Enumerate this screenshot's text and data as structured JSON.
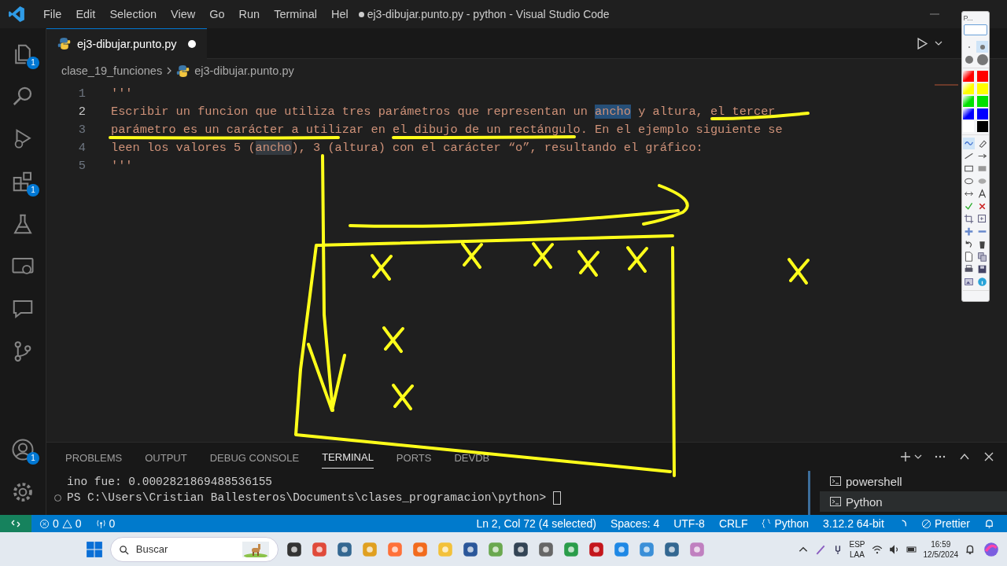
{
  "menu": [
    "File",
    "Edit",
    "Selection",
    "View",
    "Go",
    "Run",
    "Terminal",
    "Hel"
  ],
  "window": {
    "title": "ej3-dibujar.punto.py - python - Visual Studio Code",
    "modified": true
  },
  "activity_bar": {
    "badges": {
      "explorer": "1",
      "extensions": "1",
      "accounts": "1"
    }
  },
  "tab": {
    "label": "ej3-dibujar.punto.py",
    "modified": true
  },
  "breadcrumbs": [
    "clase_19_funciones",
    "ej3-dibujar.punto.py"
  ],
  "code_lines": [
    {
      "number": "1",
      "current": false,
      "parts": [
        {
          "text": "'''",
          "kind": "plain"
        }
      ]
    },
    {
      "number": "2",
      "current": true,
      "parts": [
        {
          "text": "Escribir un funcion que utiliza tres parámetros que representan un ",
          "kind": "plain"
        },
        {
          "text": "ancho",
          "kind": "selection"
        },
        {
          "text": " y altura, el tercer",
          "kind": "plain"
        }
      ]
    },
    {
      "number": "3",
      "current": false,
      "parts": [
        {
          "text": "parámetro es un carácter a utilizar en el dibujo de un rectángulo. En el ejemplo siguiente se",
          "kind": "plain"
        }
      ]
    },
    {
      "number": "4",
      "current": false,
      "parts": [
        {
          "text": "leen los valores 5 (",
          "kind": "plain"
        },
        {
          "text": "ancho",
          "kind": "occurrence"
        },
        {
          "text": "), 3 (altura) con el carácter “o”, resultando el gráfico:",
          "kind": "plain"
        }
      ]
    },
    {
      "number": "5",
      "current": false,
      "parts": [
        {
          "text": "'''",
          "kind": "plain"
        }
      ]
    }
  ],
  "panel_tabs": [
    {
      "label": "PROBLEMS",
      "selected": false
    },
    {
      "label": "OUTPUT",
      "selected": false
    },
    {
      "label": "DEBUG CONSOLE",
      "selected": false
    },
    {
      "label": "TERMINAL",
      "selected": true
    },
    {
      "label": "PORTS",
      "selected": false
    },
    {
      "label": "DEVDB",
      "selected": false
    }
  ],
  "terminal_lines": [
    "ino fue: 0.0002821869488536155",
    "PS C:\\Users\\Cristian Ballesteros\\Documents\\clases_programacion\\python> "
  ],
  "terminals": [
    {
      "label": "powershell",
      "selected": false
    },
    {
      "label": "Python",
      "selected": true
    }
  ],
  "status_bar": {
    "errors": "0",
    "warnings": "0",
    "ports": "0",
    "items": [
      "Ln 2, Col 72 (4 selected)",
      "Spaces: 4",
      "UTF-8",
      "CRLF"
    ],
    "language": "Python",
    "interpreter": "3.12.2 64-bit",
    "formatter": "Prettier"
  },
  "pen_palette": {
    "title": "P...",
    "sizes": [
      {
        "selected": false
      },
      {
        "selected": true
      },
      {
        "selected": false
      },
      {
        "selected": false
      }
    ],
    "swatches": [
      {
        "kind": "gradient",
        "color": "#ff0000"
      },
      {
        "kind": "solid",
        "color": "#ff0000"
      },
      {
        "kind": "gradient",
        "color": "#ffff00"
      },
      {
        "kind": "solid",
        "color": "#ffff00"
      },
      {
        "kind": "gradient",
        "color": "#00e000"
      },
      {
        "kind": "solid",
        "color": "#00e000"
      },
      {
        "kind": "gradient",
        "color": "#0000ff"
      },
      {
        "kind": "solid",
        "color": "#0000ff"
      },
      {
        "kind": "solid",
        "color": "#ffffff"
      },
      {
        "kind": "solid",
        "color": "#000000"
      }
    ]
  },
  "taskbar": {
    "search_placeholder": "Buscar",
    "language": "ESP",
    "layout": "LAA",
    "time": "16:59",
    "date": "12/5/2024"
  }
}
